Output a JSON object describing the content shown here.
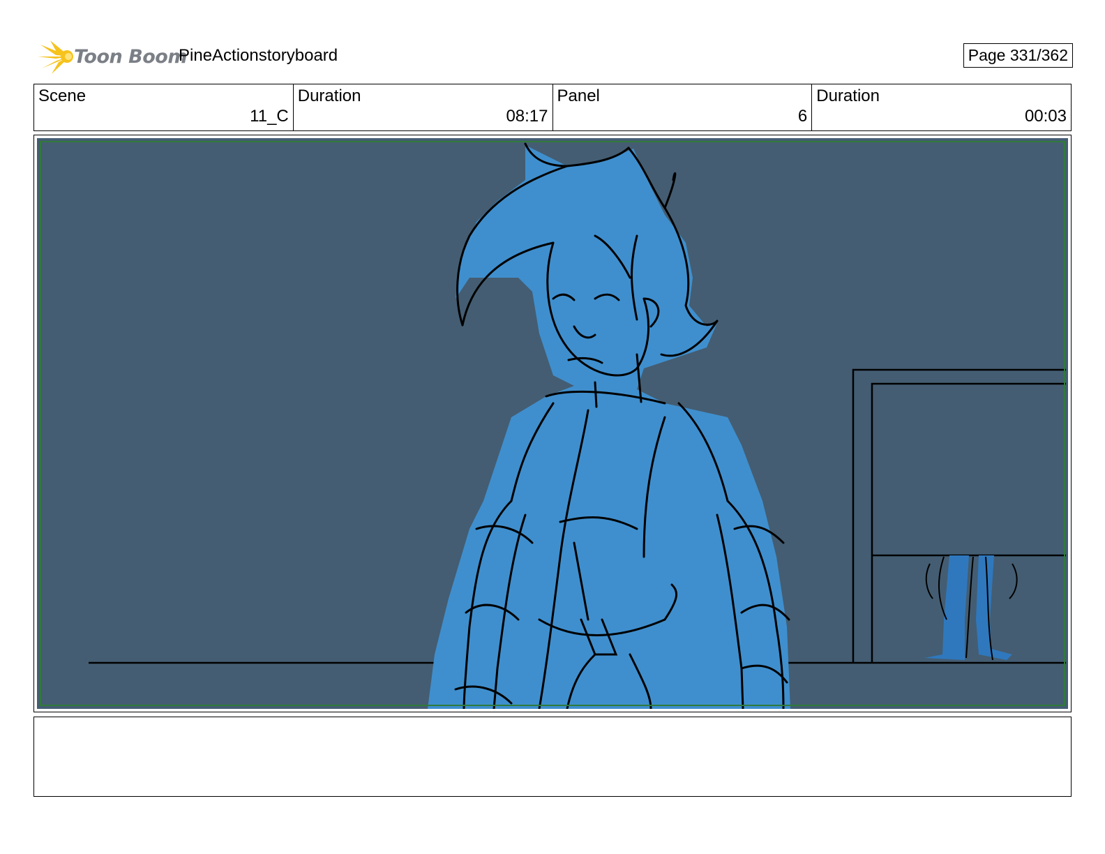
{
  "header": {
    "logo_text": "Toon Boom",
    "project_title": "PineActionstoryboard",
    "page_label": "Page 331/362"
  },
  "info": [
    {
      "label": "Scene",
      "value": "11_C"
    },
    {
      "label": "Duration",
      "value": "08:17"
    },
    {
      "label": "Panel",
      "value": "6"
    },
    {
      "label": "Duration",
      "value": "00:03"
    }
  ],
  "colors": {
    "background": "#445d72",
    "character_fill": "#3f8fce",
    "safe_frame": "#2f7a3a",
    "logo_yellow": "#f6c21c"
  },
  "notes": ""
}
